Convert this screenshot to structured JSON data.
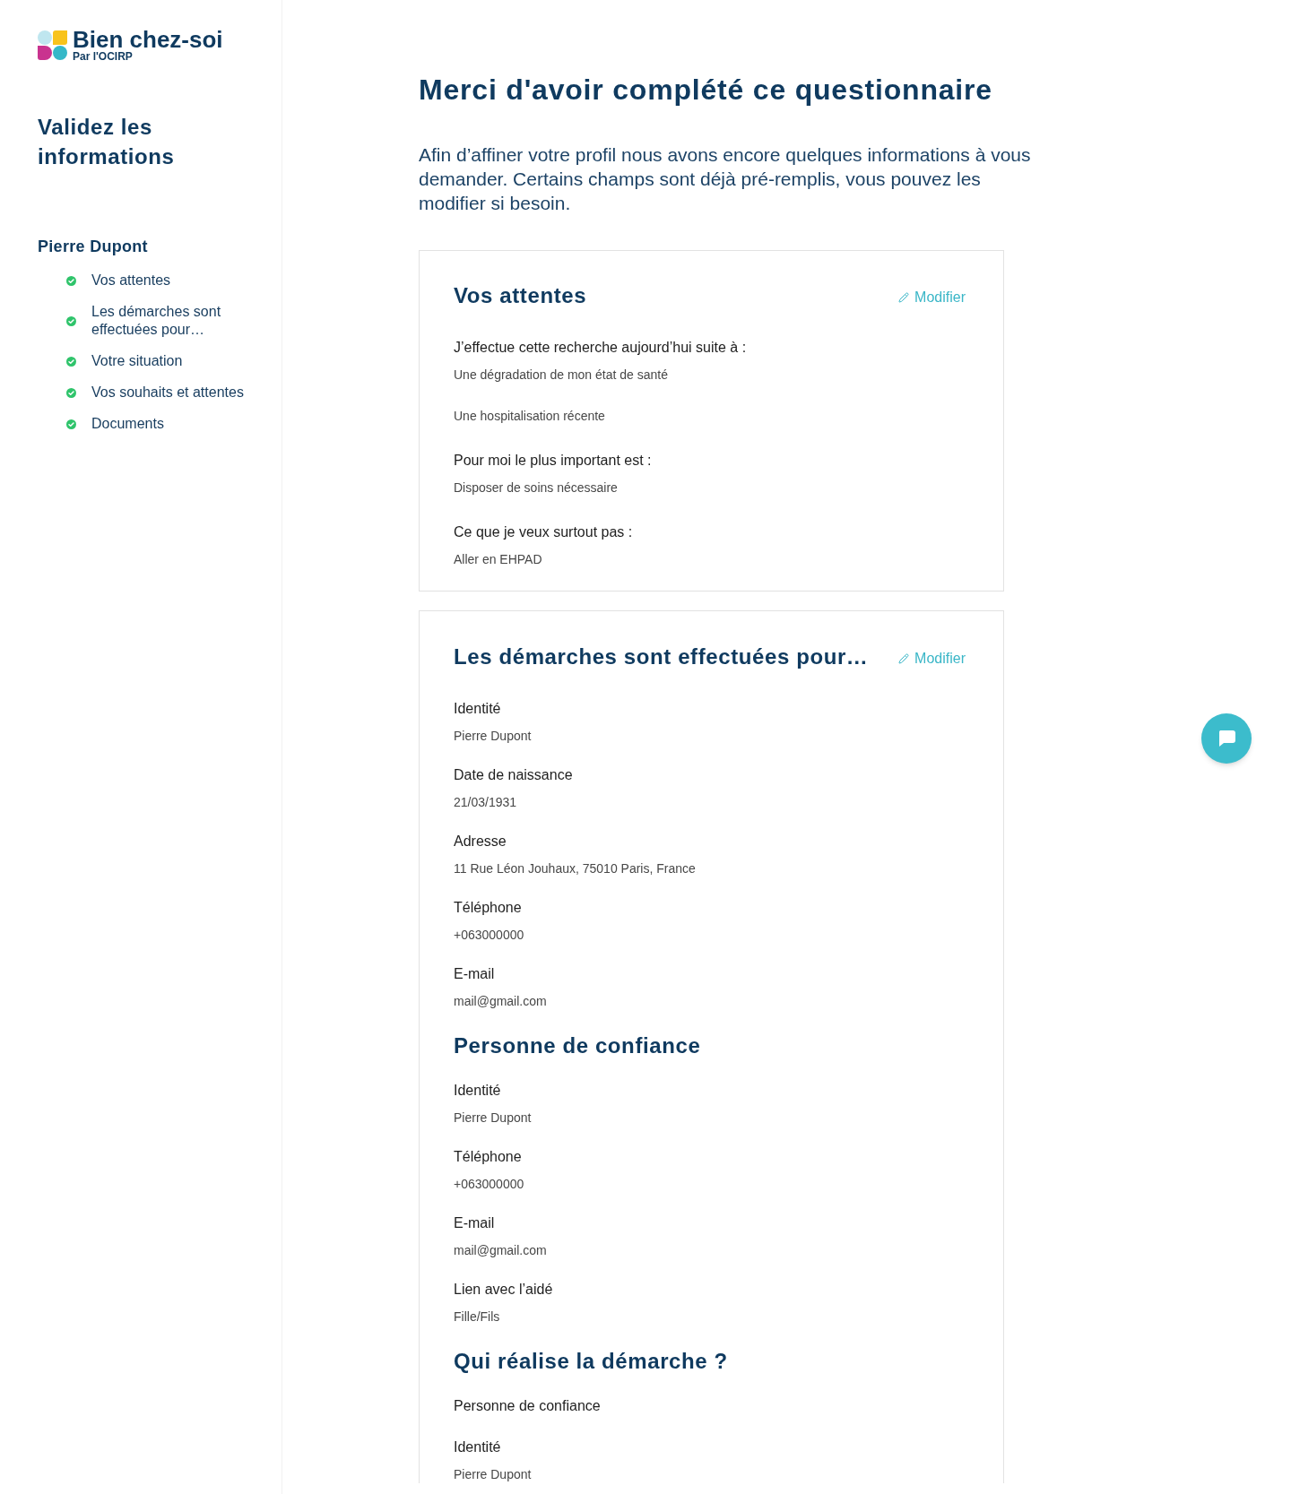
{
  "logo": {
    "name": "Bien chez-soi",
    "tagline": "Par l'OCIRP"
  },
  "sidebar": {
    "title": "Validez les informations",
    "person": "Pierre Dupont",
    "steps": [
      {
        "label": "Vos attentes",
        "completed": true
      },
      {
        "label": "Les démarches sont effectuées pour…",
        "completed": true
      },
      {
        "label": "Votre situation",
        "completed": true
      },
      {
        "label": "Vos souhaits et attentes",
        "completed": true
      },
      {
        "label": "Documents",
        "completed": true
      }
    ]
  },
  "header": {
    "title": "Merci d'avoir complété ce questionnaire",
    "intro": "Afin d’affiner votre profil nous avons encore quelques informations à vous demander. Certains champs sont déjà pré-remplis, vous pouvez les modifier si besoin."
  },
  "cards": [
    {
      "title": "Vos attentes",
      "action": "Modifier",
      "items": [
        {
          "kind": "question",
          "label": "J’effectue cette recherche aujourd’hui suite à :",
          "answers": [
            "Une dégradation de mon état de santé",
            "Une hospitalisation récente"
          ]
        },
        {
          "kind": "question",
          "label": "Pour moi le plus important est :",
          "answers": [
            "Disposer de soins nécessaire"
          ]
        },
        {
          "kind": "question",
          "label": "Ce que je veux surtout pas :",
          "answers": [
            "Aller en EHPAD"
          ]
        }
      ]
    },
    {
      "title": "Les démarches sont effectuées pour…",
      "action": "Modifier",
      "items": [
        {
          "kind": "field",
          "label": "Identité",
          "value": "Pierre Dupont"
        },
        {
          "kind": "field",
          "label": "Date de naissance",
          "value": "21/03/1931"
        },
        {
          "kind": "field",
          "label": "Adresse",
          "value": "11 Rue Léon Jouhaux, 75010 Paris, France"
        },
        {
          "kind": "field",
          "label": "Téléphone",
          "value": "+063000000"
        },
        {
          "kind": "field",
          "label": "E-mail",
          "value": "mail@gmail.com"
        },
        {
          "kind": "heading",
          "text": "Personne de confiance"
        },
        {
          "kind": "field",
          "label": "Identité",
          "value": "Pierre Dupont"
        },
        {
          "kind": "field",
          "label": "Téléphone",
          "value": "+063000000"
        },
        {
          "kind": "field",
          "label": "E-mail",
          "value": "mail@gmail.com"
        },
        {
          "kind": "field",
          "label": "Lien avec l’aidé",
          "value": "Fille/Fils"
        },
        {
          "kind": "heading",
          "text": "Qui réalise la démarche ?"
        },
        {
          "kind": "text",
          "text": "Personne de confiance"
        },
        {
          "kind": "field",
          "label": "Identité",
          "value": "Pierre Dupont"
        }
      ]
    }
  ]
}
